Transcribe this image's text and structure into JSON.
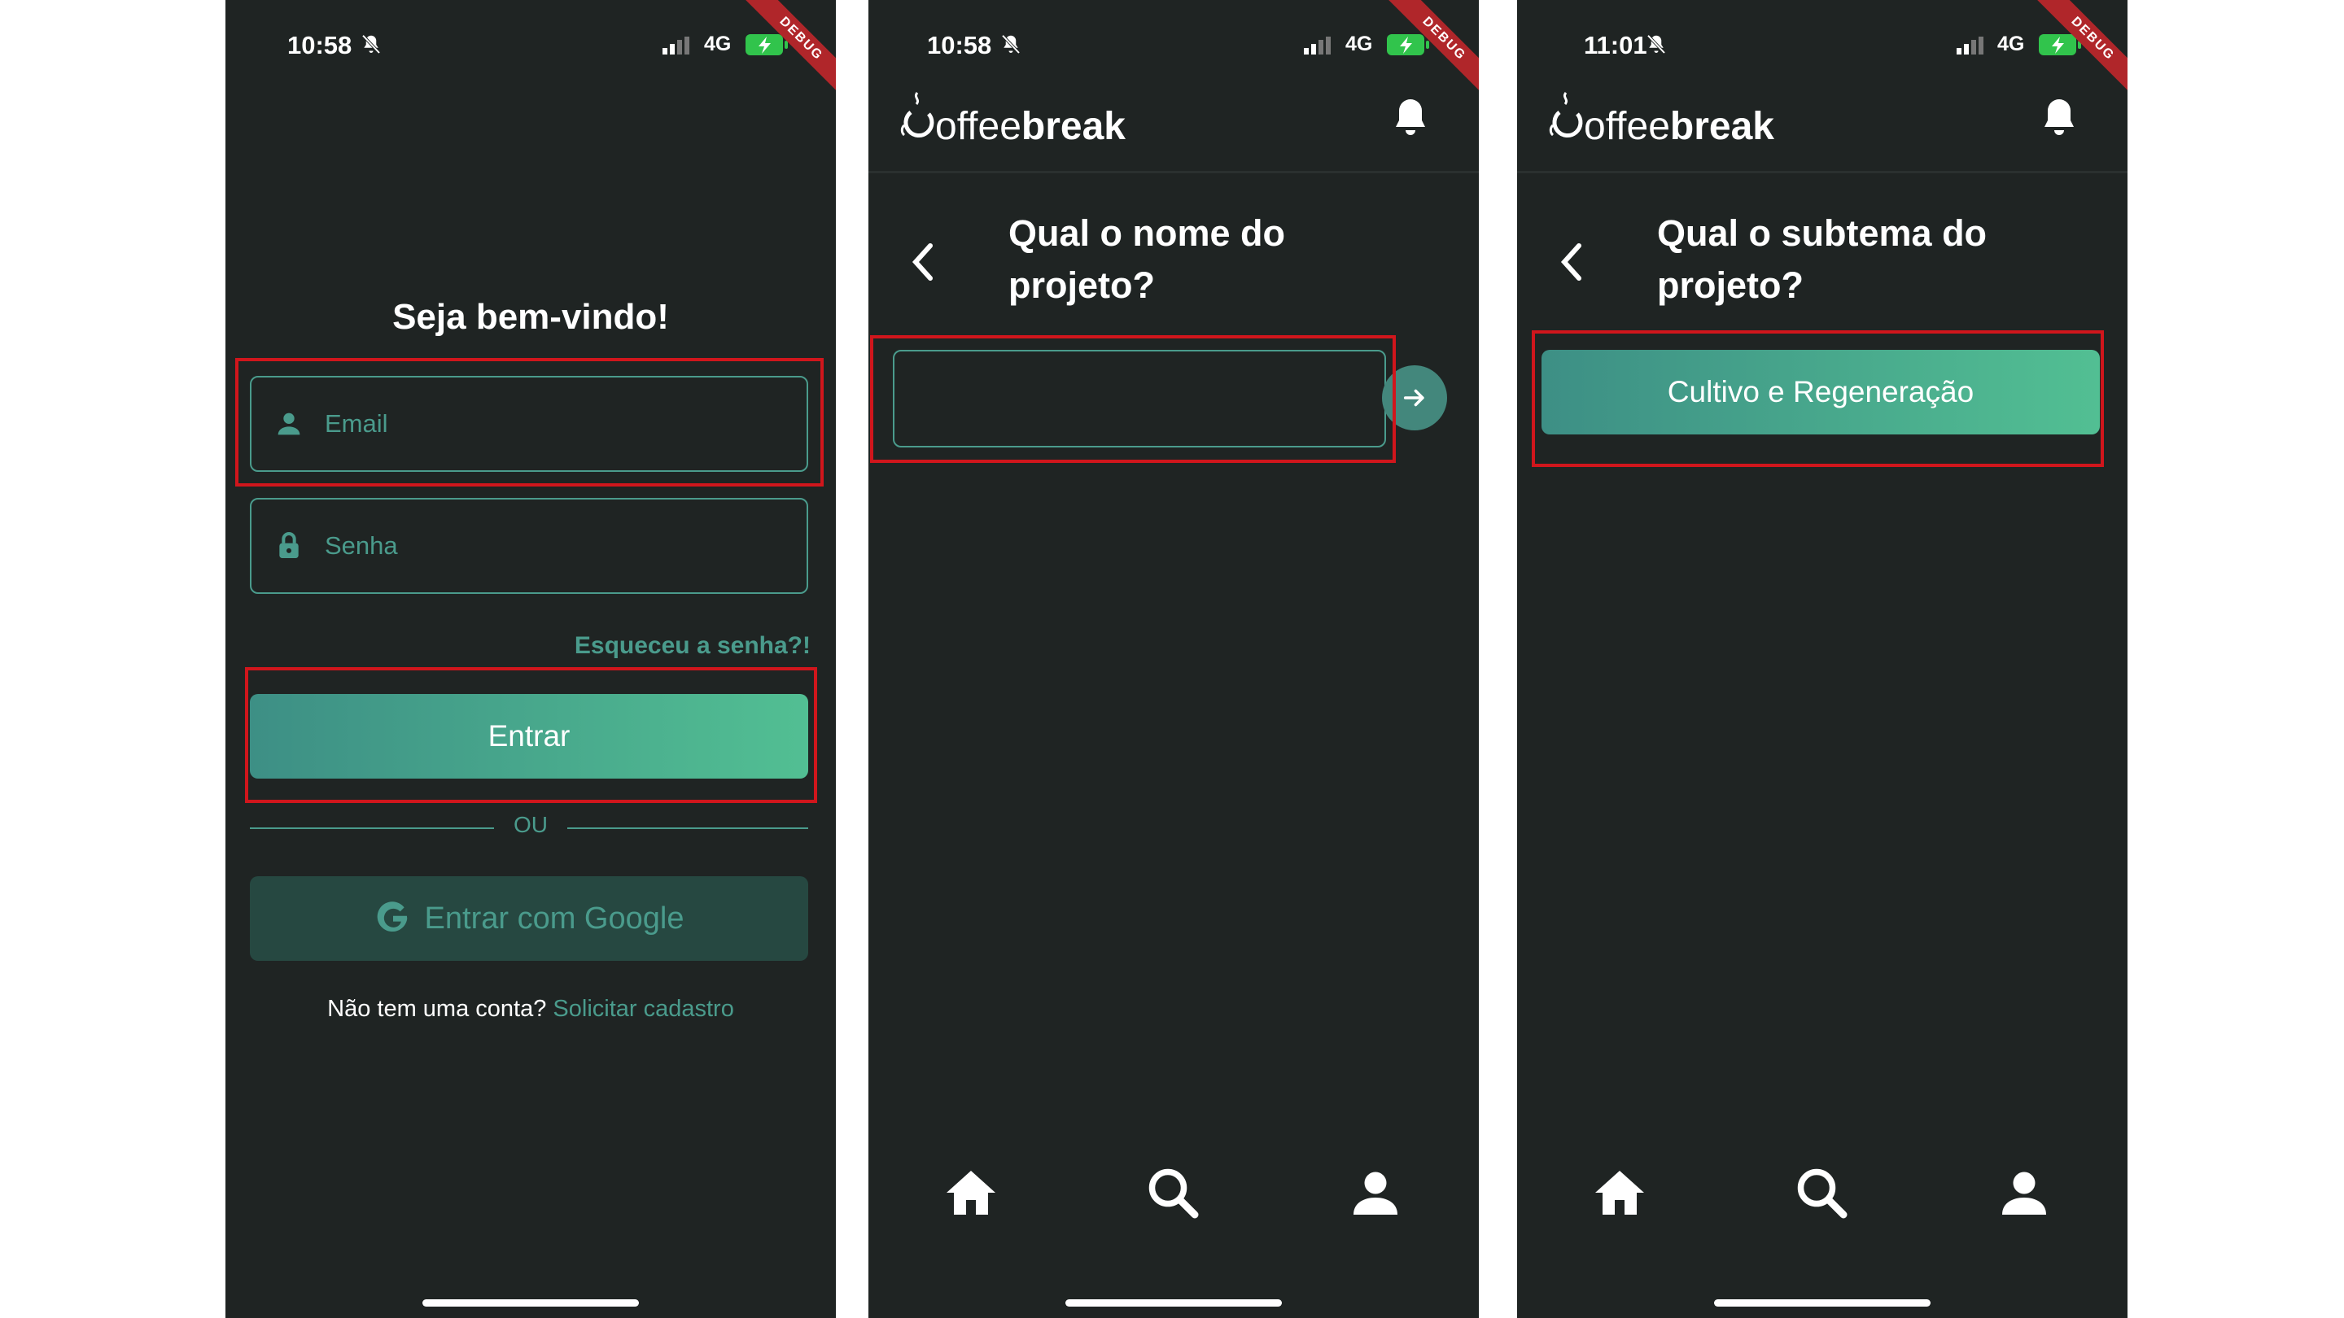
{
  "status": {
    "phone1_time": "10:58",
    "phone2_time": "10:58",
    "phone3_time": "11:01",
    "network": "4G",
    "debug_label": "DEBUG"
  },
  "brand": {
    "logo_light": "offee",
    "logo_bold": "break"
  },
  "login": {
    "title": "Seja bem-vindo!",
    "email_placeholder": "Email",
    "password_placeholder": "Senha",
    "forgot_password": "Esqueceu a senha?!",
    "login_button": "Entrar",
    "divider_text": "OU",
    "google_button": "Entrar com Google",
    "signup_prompt": "Não tem uma conta?",
    "signup_link": "Solicitar cadastro"
  },
  "project_name": {
    "question_line1": "Qual o nome do",
    "question_line2": "projeto?",
    "input_value": ""
  },
  "project_subtheme": {
    "question_line1": "Qual o subtema do",
    "question_line2": "projeto?",
    "option": "Cultivo e Regeneração"
  },
  "nav": {
    "icons": [
      "home-icon",
      "search-icon",
      "profile-icon"
    ]
  },
  "colors": {
    "background": "#1f2423",
    "accent": "#4a9b8c",
    "gradient_start": "#3d8f85",
    "gradient_end": "#52bf93",
    "google_button_bg": "#264841",
    "highlight": "#d0161c"
  }
}
